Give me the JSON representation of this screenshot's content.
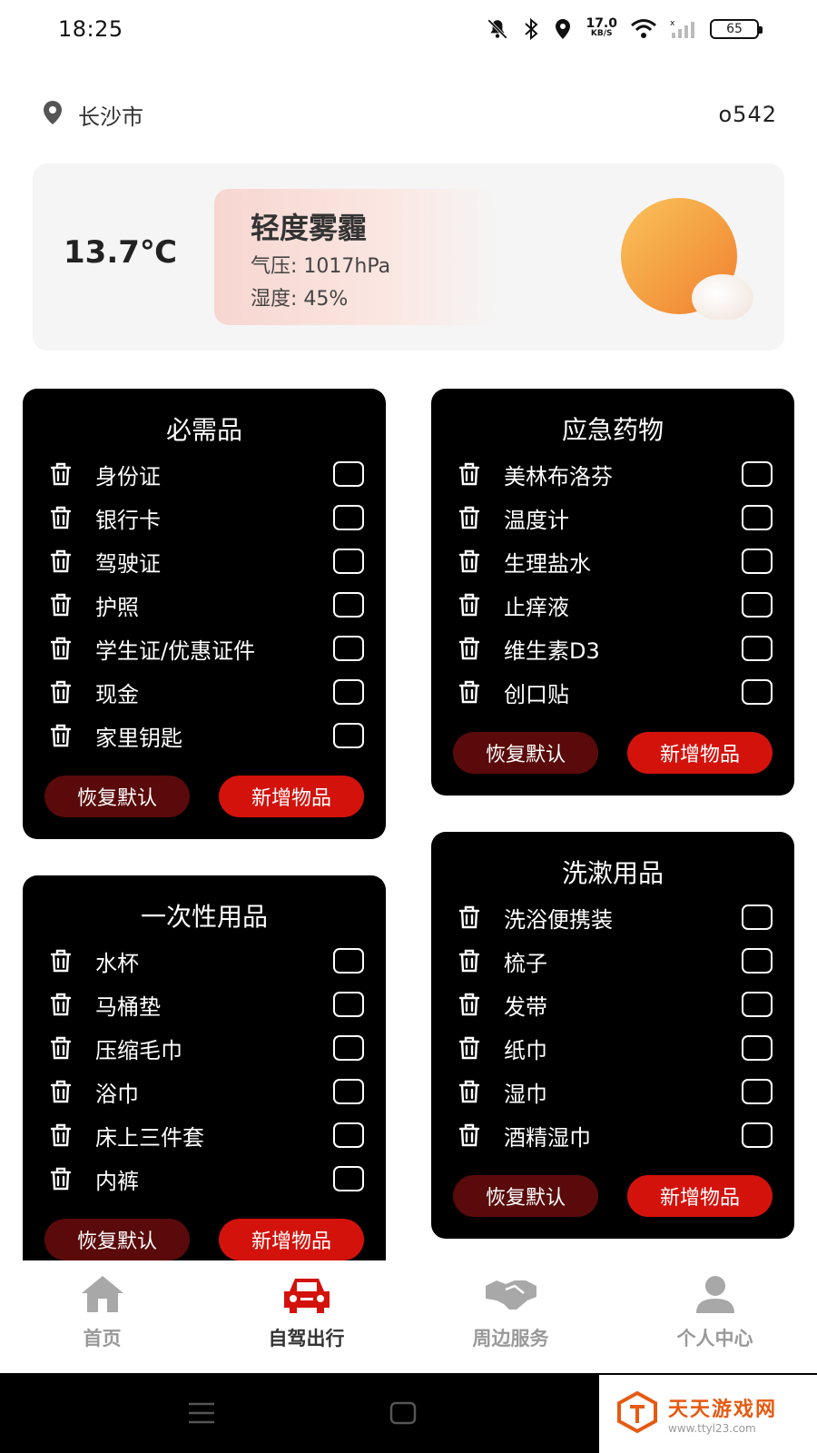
{
  "status_bar": {
    "time": "18:25",
    "net_speed_value": "17.0",
    "net_speed_unit": "KB/S",
    "battery": "65"
  },
  "location": {
    "city": "长沙市",
    "code": "o542"
  },
  "weather": {
    "temperature": "13.7℃",
    "condition": "轻度雾霾",
    "pressure": "气压:  1017hPa",
    "humidity": "湿度:  45%"
  },
  "cards": [
    {
      "title": "必需品",
      "items": [
        "身份证",
        "银行卡",
        "驾驶证",
        "护照",
        "学生证/优惠证件",
        "现金",
        "家里钥匙"
      ],
      "reset_label": "恢复默认",
      "add_label": "新增物品"
    },
    {
      "title": "应急药物",
      "items": [
        "美林布洛芬",
        "温度计",
        "生理盐水",
        "止痒液",
        "维生素D3",
        "创口贴"
      ],
      "reset_label": "恢复默认",
      "add_label": "新增物品"
    },
    {
      "title": "一次性用品",
      "items": [
        "水杯",
        "马桶垫",
        "压缩毛巾",
        "浴巾",
        "床上三件套",
        "内裤"
      ],
      "reset_label": "恢复默认",
      "add_label": "新增物品"
    },
    {
      "title": "洗漱用品",
      "items": [
        "洗浴便携装",
        "梳子",
        "发带",
        "纸巾",
        "湿巾",
        "酒精湿巾"
      ],
      "reset_label": "恢复默认",
      "add_label": "新增物品"
    }
  ],
  "tabs": [
    {
      "label": "首页",
      "icon": "home-icon",
      "active": false
    },
    {
      "label": "自驾出行",
      "icon": "car-icon",
      "active": true
    },
    {
      "label": "周边服务",
      "icon": "handshake-icon",
      "active": false
    },
    {
      "label": "个人中心",
      "icon": "person-icon",
      "active": false
    }
  ],
  "watermark": {
    "title": "天天游戏网",
    "url": "www.ttyl23.com"
  },
  "colors": {
    "accent_red": "#d4120c",
    "dark_red": "#5a0a0a",
    "card_bg": "#000000",
    "sun_orange": "#f5a34a"
  }
}
